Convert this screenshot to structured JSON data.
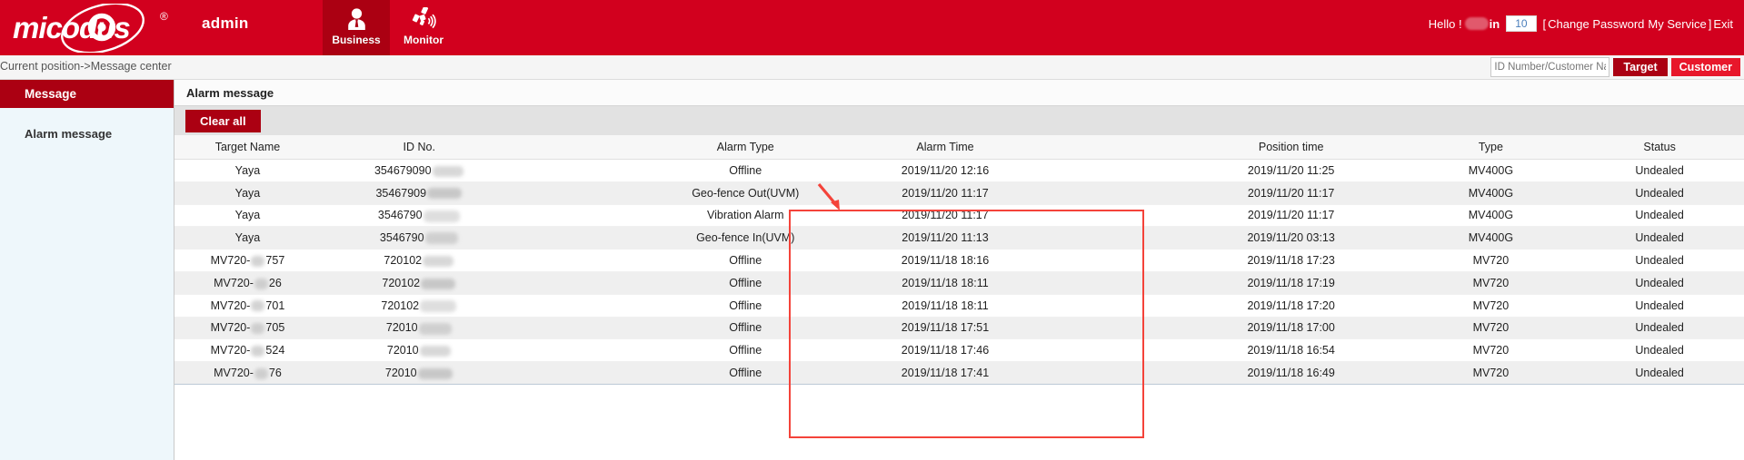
{
  "header": {
    "brand": "MICODUS",
    "brand_reg": "®",
    "admin_label": "admin",
    "tabs": [
      {
        "label": "Business",
        "icon": "user-icon",
        "active": true
      },
      {
        "label": "Monitor",
        "icon": "satellite-icon",
        "active": false
      }
    ],
    "user": {
      "hello": "Hello !",
      "name_suffix": "in",
      "count": "10",
      "bracket_open": "[",
      "change_password": "Change Password",
      "my_service": "My Service",
      "bracket_close": "]",
      "exit": "Exit"
    },
    "accent_red": "#d2001e",
    "accent_dark_red": "#ab0012"
  },
  "breadcrumb": {
    "text": "Current position->Message center",
    "search_placeholder": "ID Number/Customer Name",
    "search_value": "",
    "target_button": "Target",
    "customer_button": "Customer"
  },
  "sidebar": {
    "head": "Message",
    "items": [
      {
        "label": "Alarm message"
      }
    ]
  },
  "main": {
    "title": "Alarm message",
    "clear_all_button": "Clear all"
  },
  "table": {
    "columns": [
      "Target Name",
      "ID No.",
      "Alarm Type",
      "Alarm Time",
      "Position time",
      "Type",
      "Status"
    ],
    "rows": [
      {
        "target_name": "Yaya",
        "target_redacted": false,
        "id_prefix": "354679090",
        "id_blob": "b1",
        "alarm_type": "Offline",
        "alarm_time": "2019/11/20 12:16",
        "position_time": "2019/11/20 11:25",
        "type": "MV400G",
        "status": "Undealed"
      },
      {
        "target_name": "Yaya",
        "target_redacted": false,
        "id_prefix": "35467909",
        "id_blob": "b2",
        "alarm_type": "Geo-fence Out(UVM)",
        "alarm_time": "2019/11/20 11:17",
        "position_time": "2019/11/20 11:17",
        "type": "MV400G",
        "status": "Undealed"
      },
      {
        "target_name": "Yaya",
        "target_redacted": false,
        "id_prefix": "3546790",
        "id_blob": "b3",
        "alarm_type": "Vibration Alarm",
        "alarm_time": "2019/11/20 11:17",
        "position_time": "2019/11/20 11:17",
        "type": "MV400G",
        "status": "Undealed"
      },
      {
        "target_name": "Yaya",
        "target_redacted": false,
        "id_prefix": "3546790",
        "id_blob": "b4",
        "alarm_type": "Geo-fence In(UVM)",
        "alarm_time": "2019/11/20 11:13",
        "position_time": "2019/11/20 03:13",
        "type": "MV400G",
        "status": "Undealed"
      },
      {
        "target_name_pre": "MV720-",
        "target_name_post": "757",
        "target_redacted": true,
        "id_prefix": "720102",
        "id_blob": "b1",
        "alarm_type": "Offline",
        "alarm_time": "2019/11/18 18:16",
        "position_time": "2019/11/18 17:23",
        "type": "MV720",
        "status": "Undealed"
      },
      {
        "target_name_pre": "MV720-",
        "target_name_post": "26",
        "target_redacted": true,
        "id_prefix": "720102",
        "id_blob": "b2",
        "alarm_type": "Offline",
        "alarm_time": "2019/11/18 18:11",
        "position_time": "2019/11/18 17:19",
        "type": "MV720",
        "status": "Undealed"
      },
      {
        "target_name_pre": "MV720-",
        "target_name_post": "701",
        "target_redacted": true,
        "id_prefix": "720102",
        "id_blob": "b3",
        "alarm_type": "Offline",
        "alarm_time": "2019/11/18 18:11",
        "position_time": "2019/11/18 17:20",
        "type": "MV720",
        "status": "Undealed"
      },
      {
        "target_name_pre": "MV720-",
        "target_name_post": "705",
        "target_redacted": true,
        "id_prefix": "72010",
        "id_blob": "b4",
        "alarm_type": "Offline",
        "alarm_time": "2019/11/18 17:51",
        "position_time": "2019/11/18 17:00",
        "type": "MV720",
        "status": "Undealed"
      },
      {
        "target_name_pre": "MV720-",
        "target_name_post": "524",
        "target_redacted": true,
        "id_prefix": "72010",
        "id_blob": "b1",
        "alarm_type": "Offline",
        "alarm_time": "2019/11/18 17:46",
        "position_time": "2019/11/18 16:54",
        "type": "MV720",
        "status": "Undealed"
      },
      {
        "target_name_pre": "MV720-",
        "target_name_post": "76",
        "target_redacted": true,
        "id_prefix": "72010",
        "id_blob": "b2",
        "alarm_type": "Offline",
        "alarm_time": "2019/11/18 17:41",
        "position_time": "2019/11/18 16:49",
        "type": "MV720",
        "status": "Undealed"
      }
    ]
  },
  "annotation": {
    "highlight_color": "#f4433a",
    "highlighted_columns": [
      "Alarm Type",
      "Alarm Time"
    ]
  }
}
